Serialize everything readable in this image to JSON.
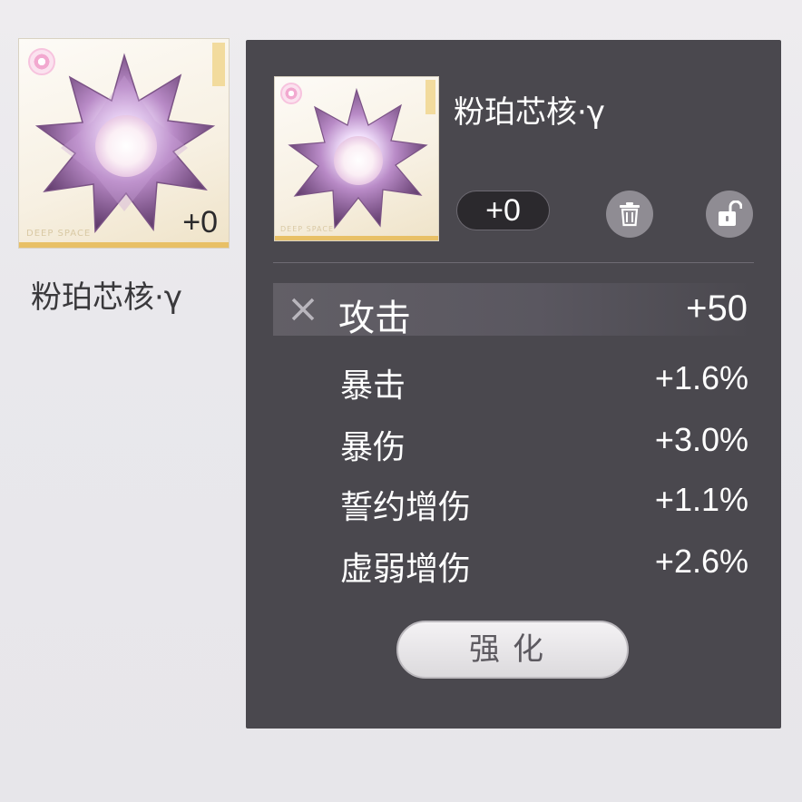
{
  "item": {
    "name": "粉珀芯核·γ",
    "level": "+0",
    "card_tag": "DEEP SPACE"
  },
  "main_stat": {
    "label": "攻击",
    "value": "+50"
  },
  "sub_stats": [
    {
      "label": "暴击",
      "value": "+1.6%"
    },
    {
      "label": "暴伤",
      "value": "+3.0%"
    },
    {
      "label": "誓约增伤",
      "value": "+1.1%"
    },
    {
      "label": "虚弱增伤",
      "value": "+2.6%"
    }
  ],
  "actions": {
    "enhance_label": "强化"
  },
  "icons": {
    "delete": "trash-icon",
    "lock": "unlock-icon",
    "main_stat": "crossed-swords-icon"
  },
  "colors": {
    "panel_bg": "#4a484e",
    "card_gold": "#e8c066",
    "gem_pink": "#d9a6e3"
  }
}
